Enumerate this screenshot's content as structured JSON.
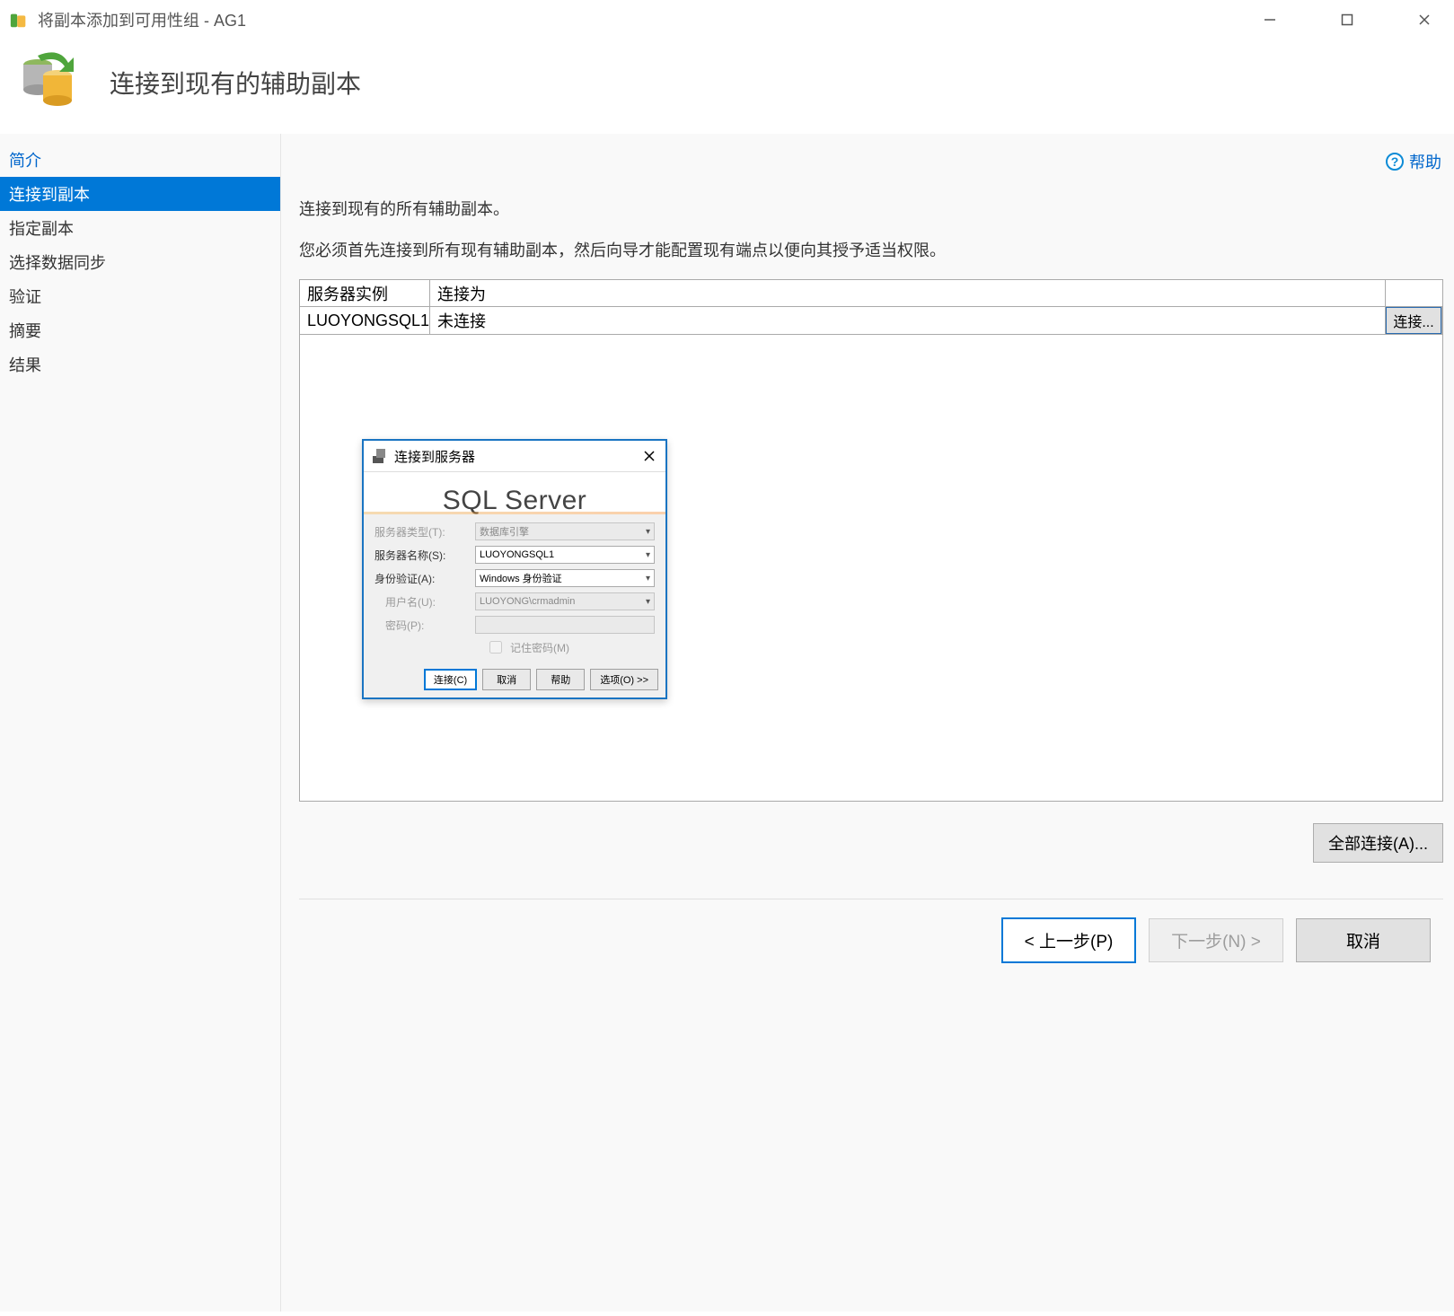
{
  "window": {
    "title": "将副本添加到可用性组 - AG1"
  },
  "header": {
    "title": "连接到现有的辅助副本"
  },
  "help": {
    "label": "帮助"
  },
  "sidebar": {
    "items": [
      {
        "label": "简介",
        "link": true,
        "active": false
      },
      {
        "label": "连接到副本",
        "link": false,
        "active": true
      },
      {
        "label": "指定副本",
        "link": false,
        "active": false
      },
      {
        "label": "选择数据同步",
        "link": false,
        "active": false
      },
      {
        "label": "验证",
        "link": false,
        "active": false
      },
      {
        "label": "摘要",
        "link": false,
        "active": false
      },
      {
        "label": "结果",
        "link": false,
        "active": false
      }
    ]
  },
  "content": {
    "heading": "连接到现有的所有辅助副本。",
    "description": "您必须首先连接到所有现有辅助副本，然后向导才能配置现有端点以便向其授予适当权限。",
    "columns": {
      "server": "服务器实例",
      "as": "连接为"
    },
    "rows": [
      {
        "server": "LUOYONGSQL1",
        "as": "未连接",
        "action": "连接..."
      }
    ],
    "connect_all": "全部连接(A)..."
  },
  "nav": {
    "prev": "< 上一步(P)",
    "next": "下一步(N) >",
    "cancel": "取消"
  },
  "modal": {
    "title": "连接到服务器",
    "banner": "SQL Server",
    "fields": {
      "server_type_label": "服务器类型(T):",
      "server_type_value": "数据库引擎",
      "server_name_label": "服务器名称(S):",
      "server_name_value": "LUOYONGSQL1",
      "auth_label": "身份验证(A):",
      "auth_value": "Windows 身份验证",
      "user_label": "用户名(U):",
      "user_value": "LUOYONG\\crmadmin",
      "pwd_label": "密码(P):",
      "remember_label": "记住密码(M)"
    },
    "buttons": {
      "connect": "连接(C)",
      "cancel": "取消",
      "help": "帮助",
      "options": "选项(O) >>"
    }
  }
}
